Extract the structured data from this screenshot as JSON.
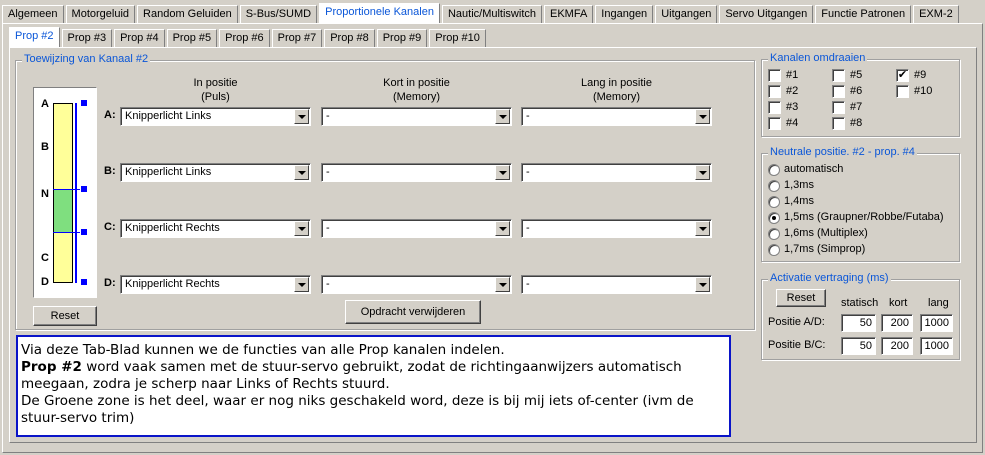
{
  "main_tabs": [
    "Algemeen",
    "Motorgeluid",
    "Random Geluiden",
    "S-Bus/SUMD",
    "Proportionele Kanalen",
    "Nautic/Multiswitch",
    "EKMFA",
    "Ingangen",
    "Uitgangen",
    "Servo Uitgangen",
    "Functie Patronen",
    "EXM-2"
  ],
  "main_active": 4,
  "sub_tabs": [
    "Prop #2",
    "Prop #3",
    "Prop #4",
    "Prop #5",
    "Prop #6",
    "Prop #7",
    "Prop #8",
    "Prop #9",
    "Prop #10"
  ],
  "sub_active": 0,
  "assign": {
    "title": "Toewijzing van Kanaal #2",
    "col1": [
      "In positie",
      "(Puls)"
    ],
    "col2": [
      "Kort in positie",
      "(Memory)"
    ],
    "col3": [
      "Lang in positie",
      "(Memory)"
    ],
    "rows": [
      {
        "label": "A:",
        "puls": "Knipperlicht Links",
        "kort": "-",
        "lang": "-"
      },
      {
        "label": "B:",
        "puls": "Knipperlicht Links",
        "kort": "-",
        "lang": "-"
      },
      {
        "label": "C:",
        "puls": "Knipperlicht Rechts",
        "kort": "-",
        "lang": "-"
      },
      {
        "label": "D:",
        "puls": "Knipperlicht Rechts",
        "kort": "-",
        "lang": "-"
      }
    ],
    "delete_button": "Opdracht verwijderen",
    "reset_button": "Reset"
  },
  "servo_bar": {
    "labels": [
      "A",
      "B",
      "N",
      "C",
      "D"
    ],
    "colors": {
      "zone": "#ffff99",
      "neutral": "#7fdf7f",
      "marker": "#0000ff"
    }
  },
  "reverse": {
    "title": "Kanalen omdraaien",
    "channels": [
      {
        "label": "#1",
        "checked": false
      },
      {
        "label": "#2",
        "checked": false
      },
      {
        "label": "#3",
        "checked": false
      },
      {
        "label": "#4",
        "checked": false
      },
      {
        "label": "#5",
        "checked": false
      },
      {
        "label": "#6",
        "checked": false
      },
      {
        "label": "#7",
        "checked": false
      },
      {
        "label": "#8",
        "checked": false
      },
      {
        "label": "#9",
        "checked": true
      },
      {
        "label": "#10",
        "checked": false
      }
    ]
  },
  "neutral": {
    "title": "Neutrale positie. #2 - prop. #4",
    "options": [
      "automatisch",
      "1,3ms",
      "1,4ms",
      "1,5ms (Graupner/Robbe/Futaba)",
      "1,6ms (Multiplex)",
      "1,7ms (Simprop)"
    ],
    "selected": 3
  },
  "delay": {
    "title": "Activatie vertraging (ms)",
    "reset_button": "Reset",
    "headers": [
      "statisch",
      "kort",
      "lang"
    ],
    "rows": [
      {
        "label": "Positie A/D:",
        "values": [
          "50",
          "200",
          "1000"
        ]
      },
      {
        "label": "Positie B/C:",
        "values": [
          "50",
          "200",
          "1000"
        ]
      }
    ]
  },
  "note": {
    "line1": "Via deze Tab-Blad kunnen we de functies van alle Prop kanalen indelen.",
    "bold": "Prop #2",
    "line2": " word vaak samen met de stuur-servo gebruikt, zodat de richtingaanwijzers automatisch meegaan, zodra je scherp naar Links of Rechts stuurd.",
    "line3": "De Groene zone is het deel, waar er nog niks geschakeld word, deze is bij mij iets of-center (ivm de stuur-servo trim)"
  }
}
